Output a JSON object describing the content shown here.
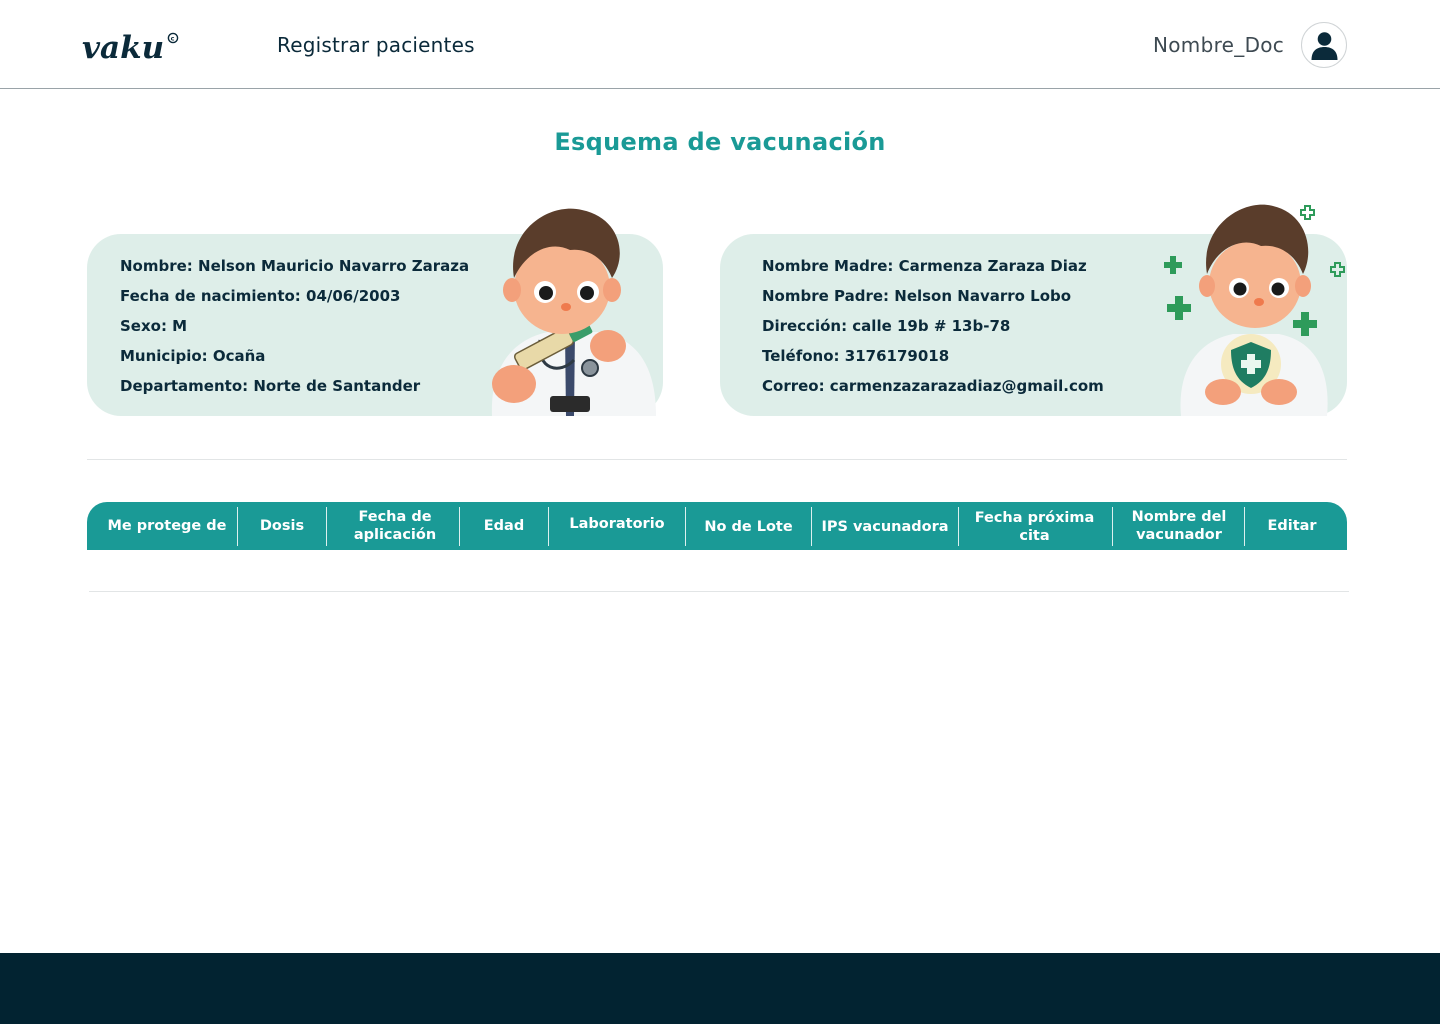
{
  "header": {
    "logo_text": "vaku",
    "nav_link": "Registrar pacientes",
    "doctor_name": "Nombre_Doc"
  },
  "page": {
    "title": "Esquema de vacunación"
  },
  "patient_card": {
    "nombre": "Nombre: Nelson Mauricio Navarro Zaraza",
    "fecha_nacimiento": "Fecha de nacimiento: 04/06/2003",
    "sexo": "Sexo: M",
    "municipio": "Municipio: Ocaña",
    "departamento": "Departamento: Norte de Santander"
  },
  "parents_card": {
    "madre": "Nombre Madre: Carmenza Zaraza Diaz",
    "padre": "Nombre Padre: Nelson Navarro Lobo",
    "direccion": "Dirección: calle 19b # 13b-78",
    "telefono": "Teléfono: 3176179018",
    "correo": "Correo: carmenzazarazadiaz@gmail.com"
  },
  "table": {
    "columns": [
      "Me protege de",
      "Dosis",
      "Fecha de aplicación",
      "Edad",
      "Laboratorio",
      "No de Lote",
      "IPS vacunadora",
      "Fecha próxima cita",
      "Nombre del vacunador",
      "Editar"
    ],
    "rows": []
  },
  "colors": {
    "accent": "#1a9a96",
    "card_bg": "#deeee9",
    "text_dark": "#0b2a3a",
    "footer_bg": "#022331"
  },
  "icons": {
    "avatar": "user-icon"
  }
}
